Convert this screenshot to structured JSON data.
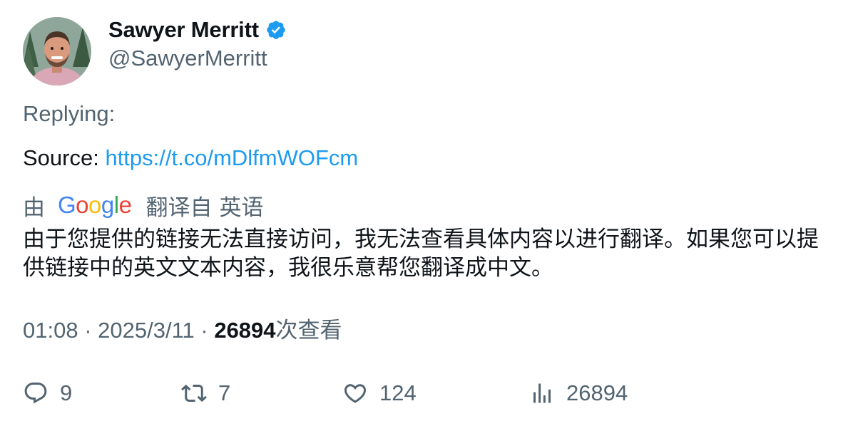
{
  "author": {
    "display_name": "Sawyer Merritt",
    "handle": "@SawyerMerritt",
    "verified_icon": "verified-badge-icon",
    "verified_color": "#1d9bf0"
  },
  "tweet": {
    "replying_label": "Replying:",
    "source_label": "Source: ",
    "source_link": "https://t.co/mDlfmWOFcm"
  },
  "translation": {
    "by_label": "由",
    "provider": "Google",
    "translated_from": "翻译自",
    "language": "英语",
    "text": "由于您提供的链接无法直接访问，我无法查看具体内容以进行翻译。如果您可以提供链接中的英文文本内容，我很乐意帮您翻译成中文。"
  },
  "meta": {
    "time": "01:08",
    "separator1": " · ",
    "date": "2025/3/11",
    "separator2": " · ",
    "views_count": "26894",
    "views_label": "次查看"
  },
  "actions": {
    "reply_count": "9",
    "retweet_count": "7",
    "like_count": "124",
    "views_count": "26894"
  },
  "colors": {
    "text_primary": "#0f1419",
    "text_secondary": "#536471",
    "link": "#1d9bf0"
  }
}
